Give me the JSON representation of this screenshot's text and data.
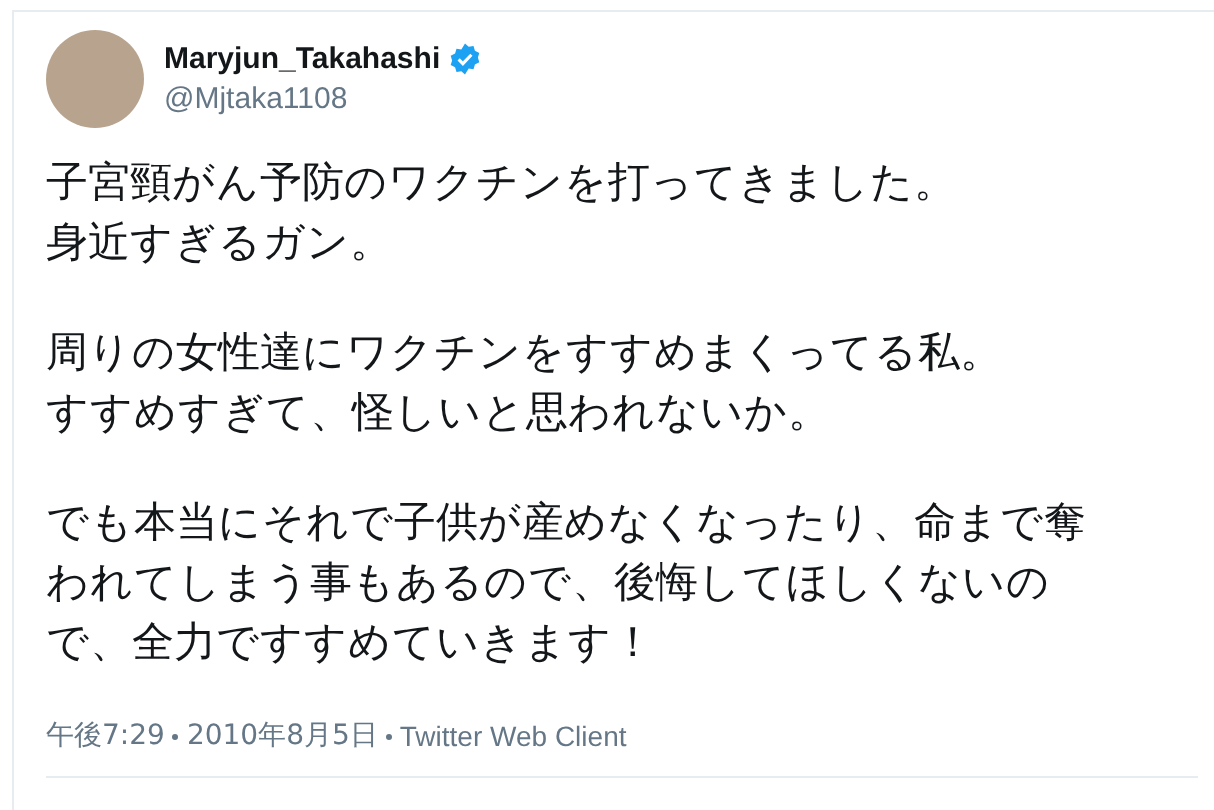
{
  "author": {
    "name": "Maryjun_Takahashi",
    "handle": "@Mjtaka1108",
    "verified": true
  },
  "paragraphs": [
    [
      "子宮頸がん予防のワクチンを打ってきました。",
      "身近すぎるガン。"
    ],
    [
      "周りの女性達にワクチンをすすめまくってる私。",
      "すすめすぎて、怪しいと思われないか。"
    ],
    [
      "でも本当にそれで子供が産めなくなったり、命まで奪",
      "われてしまう事もあるので、後悔してほしくないの",
      "で、全力ですすめていきます！"
    ]
  ],
  "footer": {
    "time": "午後7:29",
    "date": "2010年8月5日",
    "source": "Twitter Web Client"
  }
}
